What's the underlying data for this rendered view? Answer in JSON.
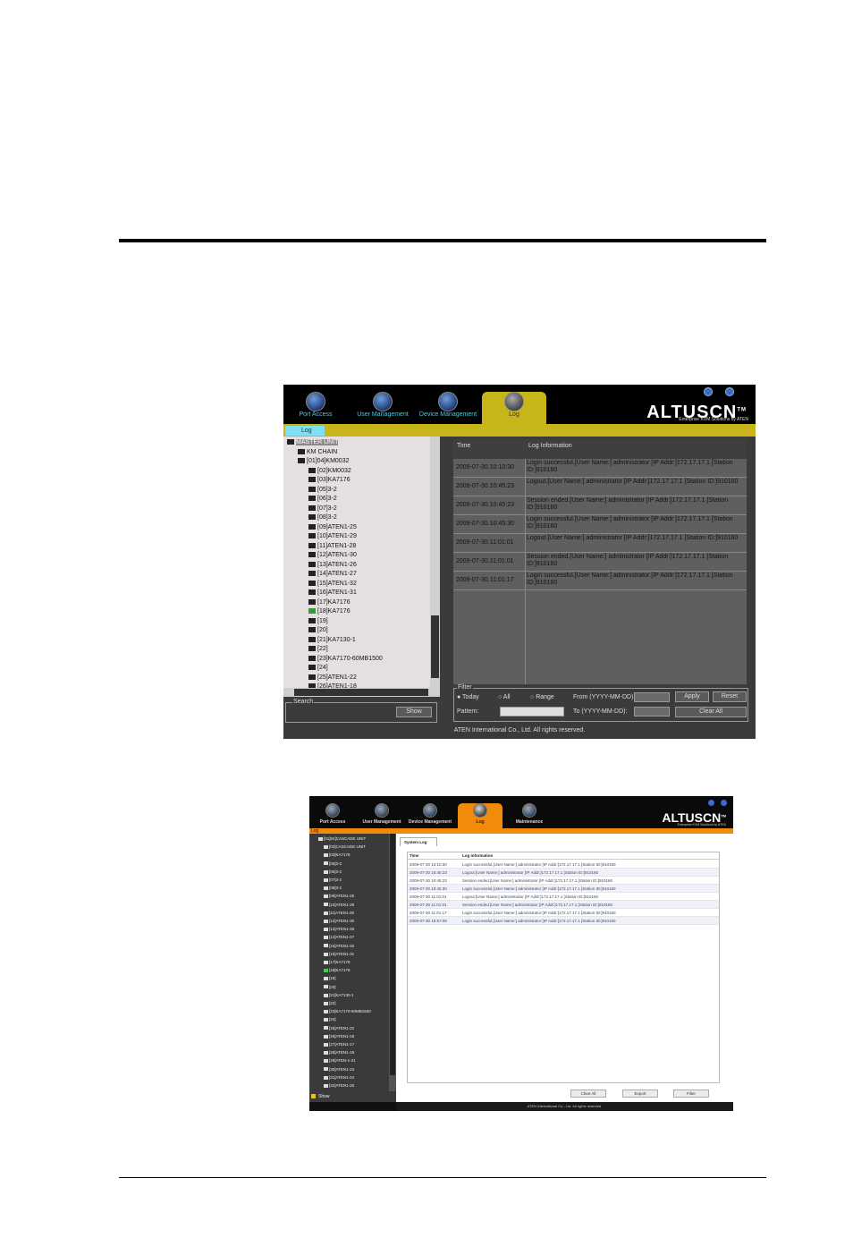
{
  "screen1": {
    "tabs": [
      {
        "label": "Port Access",
        "icon": "globe-icon"
      },
      {
        "label": "User Management",
        "icon": "users-icon"
      },
      {
        "label": "Device Management",
        "icon": "device-icon"
      },
      {
        "label": "Log",
        "icon": "log-icon"
      }
    ],
    "logo": "ALTUSCN",
    "logo_mark": "TM",
    "tagline": "Enterprise KVM Solutions by ATEN",
    "subtab": "Log",
    "tree": [
      {
        "label": "MASTER UNIT",
        "level": 0
      },
      {
        "label": "KM CHAIN",
        "level": 1
      },
      {
        "label": "[01]04]KM0032",
        "level": 1
      },
      {
        "label": "[02]KM0032",
        "level": 2
      },
      {
        "label": "[03]KA7176",
        "level": 2
      },
      {
        "label": "[05]3-2",
        "level": 2
      },
      {
        "label": "[06]3-2",
        "level": 2
      },
      {
        "label": "[07]3-2",
        "level": 2
      },
      {
        "label": "[08]3-2",
        "level": 2
      },
      {
        "label": "[09]ATEN1-25",
        "level": 2
      },
      {
        "label": "[10]ATEN1-29",
        "level": 2
      },
      {
        "label": "[11]ATEN1-28",
        "level": 2
      },
      {
        "label": "[12]ATEN1-30",
        "level": 2
      },
      {
        "label": "[13]ATEN1-26",
        "level": 2
      },
      {
        "label": "[14]ATEN1-27",
        "level": 2
      },
      {
        "label": "[15]ATEN1-32",
        "level": 2
      },
      {
        "label": "[16]ATEN1-31",
        "level": 2
      },
      {
        "label": "[17]KA7176",
        "level": 2
      },
      {
        "label": "[18]KA7176",
        "level": 2
      },
      {
        "label": "[19]",
        "level": 2
      },
      {
        "label": "[20]",
        "level": 2
      },
      {
        "label": "[21]KA7130-1",
        "level": 2
      },
      {
        "label": "[22]",
        "level": 2
      },
      {
        "label": "[23]KA7170-60MB1500",
        "level": 2
      },
      {
        "label": "[24]",
        "level": 2
      },
      {
        "label": "[25]ATEN1-22",
        "level": 2
      },
      {
        "label": "[26]ATEN1-18",
        "level": 2
      }
    ],
    "search_label": "Search",
    "show_button": "Show",
    "columns": [
      "Time",
      "Log Information"
    ],
    "rows": [
      {
        "time": "2009-07-30.10:10:30",
        "info": "Login successful.[User Name:] administrator [IP Addr:]172.17.17.1 [Station ID:]910160"
      },
      {
        "time": "2009-07-30.10:45:23",
        "info": "Logout.[User Name:] administrator [IP Addr:]172.17.17.1 [Station ID:]910160"
      },
      {
        "time": "2009-07-30.10:45:23",
        "info": "Session ended.[User Name:] administrator [IP Addr:]172.17.17.1 [Station ID:]910160"
      },
      {
        "time": "2009-07-30.10:45:30",
        "info": "Login successful.[User Name:] administrator [IP Addr:]172.17.17.1 [Station ID:]910160"
      },
      {
        "time": "2009-07-30.11:01:01",
        "info": "Logout.[User Name:] administrator [IP Addr:]172.17.17.1 [Station ID:]910160"
      },
      {
        "time": "2009-07-30.11:01:01",
        "info": "Session ended.[User Name:] administrator [IP Addr:]172.17.17.1 [Station ID:]910160"
      },
      {
        "time": "2009-07-30.11:01:17",
        "info": "Login successful.[User Name:] administrator [IP Addr:]172.17.17.1 [Station ID:]910160"
      }
    ],
    "filter": {
      "label": "Filter",
      "today": "Today",
      "all": "All",
      "range": "Range",
      "from": "From (YYYY-MM-DD):",
      "to": "To (YYYY-MM-DD):",
      "pattern": "Pattern:",
      "apply": "Apply",
      "reset": "Reset",
      "clear_all": "Clear All"
    },
    "footer": "ATEN International Co., Ltd. All rights reserved."
  },
  "screen2": {
    "tabs": [
      {
        "label": "Port Access",
        "icon": "globe-icon"
      },
      {
        "label": "User Management",
        "icon": "users-icon"
      },
      {
        "label": "Device Management",
        "icon": "device-icon"
      },
      {
        "label": "Log",
        "icon": "log-icon"
      },
      {
        "label": "Maintenance",
        "icon": "maintenance-icon"
      }
    ],
    "logo": "ALTUSCN",
    "logo_mark": "TM",
    "tagline": "Enterprise KVM Solutions by ATEN",
    "subtab": "Log",
    "tree": [
      "[01]04]CASCADE UNIT",
      "[02]CASCADE UNIT",
      "[03]KA7176",
      "[05]3-2",
      "[06]3-2",
      "[07]3-2",
      "[08]3-2",
      "[09]ATEN1-25",
      "[10]ATEN1-29",
      "[11]ATEN1-28",
      "[12]ATEN1-30",
      "[13]ATEN1-26",
      "[14]ATEN1-27",
      "[15]ATEN1-32",
      "[16]ATEN1-31",
      "[17]KA7176",
      "[18]KA7176",
      "[19]",
      "[20]",
      "[21]KA7130-1",
      "[22]",
      "[23]KA7170-60MB1500",
      "[24]",
      "[25]ATEN1-22",
      "[26]ATEN1-18",
      "[27]ATEN1-17",
      "[28]ATEN1-19",
      "[29]ATEN-1-21",
      "[30]ATEN1-23",
      "[31]ATEN1-24",
      "[32]ATEN1-20"
    ],
    "show_label": "Show",
    "system_tab": "System Log",
    "columns": [
      "Time",
      "Log Information"
    ],
    "rows": [
      {
        "time": "2009-07-30 10:10:30",
        "info": "Login successful.[User Name:] administrator [IP Addr:]172.17.17.1 [Station ID:]910160"
      },
      {
        "time": "2009-07-30 10:45:23",
        "info": "Logout.[User Name:] administrator [IP Addr:]172.17.17.1 [Station ID:]910160"
      },
      {
        "time": "2009-07-30 10:45:23",
        "info": "Session ended.[User Name:] administrator [IP Addr:]172.17.17.1 [Station ID:]910160"
      },
      {
        "time": "2009-07-30 10:45:30",
        "info": "Login successful.[User Name:] administrator [IP Addr:]172.17.17.1 [Station ID:]910160"
      },
      {
        "time": "2009-07-30 11:01:01",
        "info": "Logout.[User Name:] administrator [IP Addr:]172.17.17.1 [Station ID:]910160"
      },
      {
        "time": "2009-07-30 11:01:01",
        "info": "Session ended.[User Name:] administrator [IP Addr:]172.17.17.1 [Station ID:]910160"
      },
      {
        "time": "2009-07-30 11:01:17",
        "info": "Login successful.[User Name:] administrator [IP Addr:]172.17.17.1 [Station ID:]910160"
      },
      {
        "time": "2009-07-30 15:57:08",
        "info": "Login successful.[User Name:] administrator [IP Addr:]172.17.17.1 [Station ID:]910160"
      }
    ],
    "buttons": {
      "clear_all": "Clear All",
      "export": "Export",
      "filter": "Filter"
    },
    "footer": "ATEN International Co., Ltd. All rights reserved."
  }
}
